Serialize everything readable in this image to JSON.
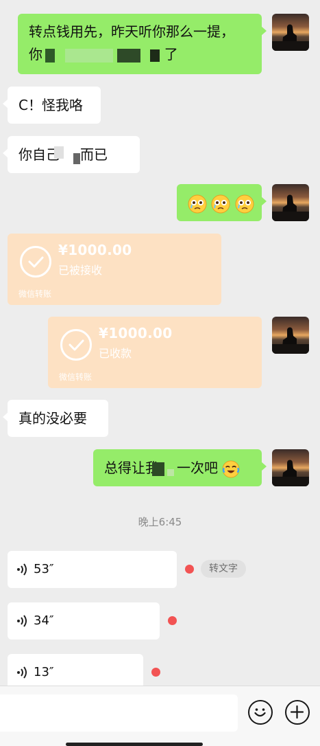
{
  "messages": {
    "m1": {
      "line1": "转点钱用先，昨天听你那么一提，",
      "line2_a": "你",
      "line2_b": "了"
    },
    "m2": {
      "text": "C！怪我咯"
    },
    "m3": {
      "text_a": "你自己",
      "text_b": "而已"
    },
    "m4": {
      "emoji": [
        "flushed-crying-face",
        "flushed-crying-face",
        "flushed-crying-face"
      ]
    },
    "t1": {
      "amount": "¥1000.00",
      "status": "已被接收",
      "footer": "微信转账"
    },
    "t2": {
      "amount": "¥1000.00",
      "status": "已收款",
      "footer": "微信转账"
    },
    "m5": {
      "text": "真的没必要"
    },
    "m6": {
      "text_a": "总得让我",
      "text_b": "一次吧",
      "emoji": "laughing-tears-face"
    }
  },
  "timestamp": "晚上6:45",
  "voices": [
    {
      "duration": "53″",
      "unread": true,
      "convert_label": "转文字"
    },
    {
      "duration": "34″",
      "unread": true
    },
    {
      "duration": "13″",
      "unread": true
    }
  ],
  "input_bar": {
    "emoji_icon": "smiley-icon",
    "plus_icon": "plus-icon"
  },
  "colors": {
    "background": "#ededed",
    "sent_bubble": "#95ec69",
    "received_bubble": "#ffffff",
    "transfer_card": "#fde1c3",
    "unread_dot": "#f25353"
  }
}
